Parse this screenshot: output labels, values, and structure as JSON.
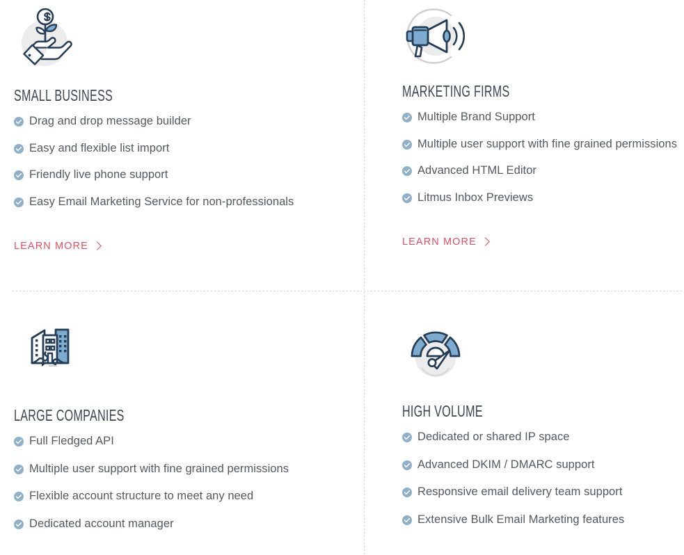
{
  "theme": {
    "accent_link": "#e04f62",
    "check_circle": "#8fb0c6",
    "icon_dark": "#253d54",
    "icon_blue": "#7eacd0",
    "icon_circle_bg": "#ececec",
    "heading_color": "#3b4550",
    "body_text": "#54585d",
    "divider": "#cfd2d6"
  },
  "cards": [
    {
      "id": "small-business",
      "icon_name": "hand-holding-money-plant-icon",
      "title": "SMALL BUSINESS",
      "features": [
        "Drag and drop message builder",
        "Easy and flexible list import",
        "Friendly live phone support",
        "Easy Email Marketing Service for non-professionals"
      ],
      "link": {
        "label": "LEARN MORE",
        "chevron": "chevron-right-icon"
      }
    },
    {
      "id": "marketing-firms",
      "icon_name": "megaphone-icon",
      "title": "MARKETING FIRMS",
      "features": [
        "Multiple Brand Support",
        "Multiple user support with fine grained permissions",
        "Advanced HTML Editor",
        "Litmus Inbox Previews"
      ],
      "link": {
        "label": "LEARN MORE",
        "chevron": "chevron-right-icon"
      }
    },
    {
      "id": "large-companies",
      "icon_name": "city-buildings-globe-icon",
      "title": "LARGE COMPANIES",
      "features": [
        "Full Fledged API",
        "Multiple user support with fine grained permissions",
        "Flexible account structure to meet any need",
        "Dedicated account manager"
      ],
      "link": null
    },
    {
      "id": "high-volume",
      "icon_name": "speedometer-gauge-icon",
      "title": "HIGH VOLUME",
      "features": [
        "Dedicated or shared IP space",
        "Advanced DKIM / DMARC support",
        "Responsive email delivery team support",
        "Extensive Bulk Email Marketing features"
      ],
      "link": null
    }
  ]
}
